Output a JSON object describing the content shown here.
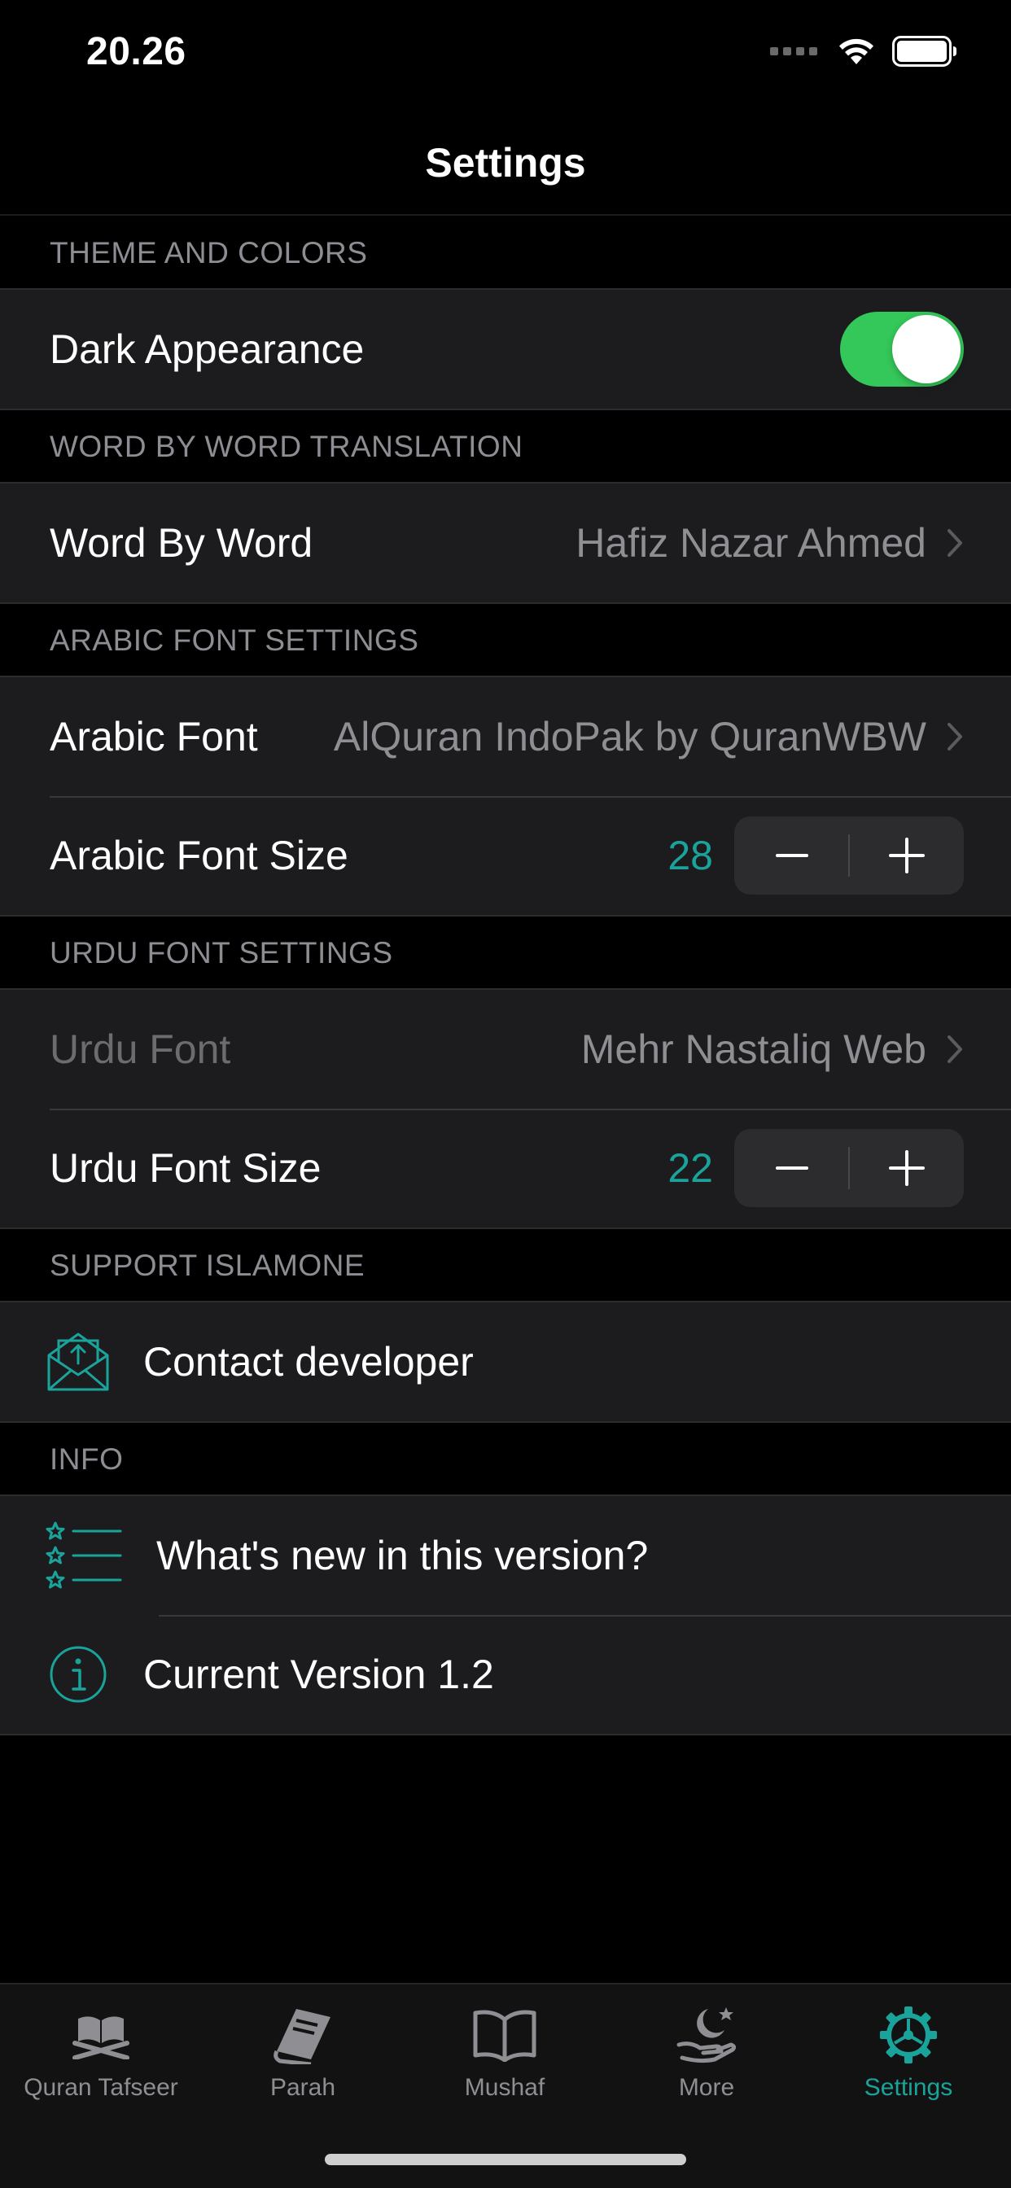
{
  "status_bar": {
    "time": "20.26"
  },
  "nav": {
    "title": "Settings"
  },
  "colors": {
    "accent": "#1aa39a",
    "toggle_on": "#34c759",
    "secondary_text": "#8e8e93"
  },
  "sections": {
    "theme": {
      "header": "THEME AND COLORS",
      "dark_appearance": {
        "label": "Dark Appearance",
        "enabled": true
      }
    },
    "wbw": {
      "header": "WORD BY WORD TRANSLATION",
      "word_by_word": {
        "label": "Word By Word",
        "value": "Hafiz Nazar Ahmed"
      }
    },
    "arabic": {
      "header": "ARABIC FONT SETTINGS",
      "font": {
        "label": "Arabic Font",
        "value": "AlQuran IndoPak by QuranWBW"
      },
      "size": {
        "label": "Arabic Font Size",
        "value": "28"
      }
    },
    "urdu": {
      "header": "URDU FONT SETTINGS",
      "font": {
        "label": "Urdu Font",
        "value": "Mehr Nastaliq Web"
      },
      "size": {
        "label": "Urdu Font Size",
        "value": "22"
      }
    },
    "support": {
      "header": "SUPPORT ISLAMONE",
      "contact": {
        "label": "Contact developer",
        "icon": "mail-icon"
      }
    },
    "info": {
      "header": "INFO",
      "whats_new": {
        "label": "What's new in this version?",
        "icon": "star-list-icon"
      },
      "version": {
        "label": "Current Version 1.2",
        "icon": "info-icon"
      }
    }
  },
  "tabs": [
    {
      "label": "Quran Tafseer",
      "icon": "quran-stand-icon",
      "active": false
    },
    {
      "label": "Parah",
      "icon": "book-icon",
      "active": false
    },
    {
      "label": "Mushaf",
      "icon": "open-book-icon",
      "active": false
    },
    {
      "label": "More",
      "icon": "moon-hand-icon",
      "active": false
    },
    {
      "label": "Settings",
      "icon": "gear-icon",
      "active": true
    }
  ]
}
